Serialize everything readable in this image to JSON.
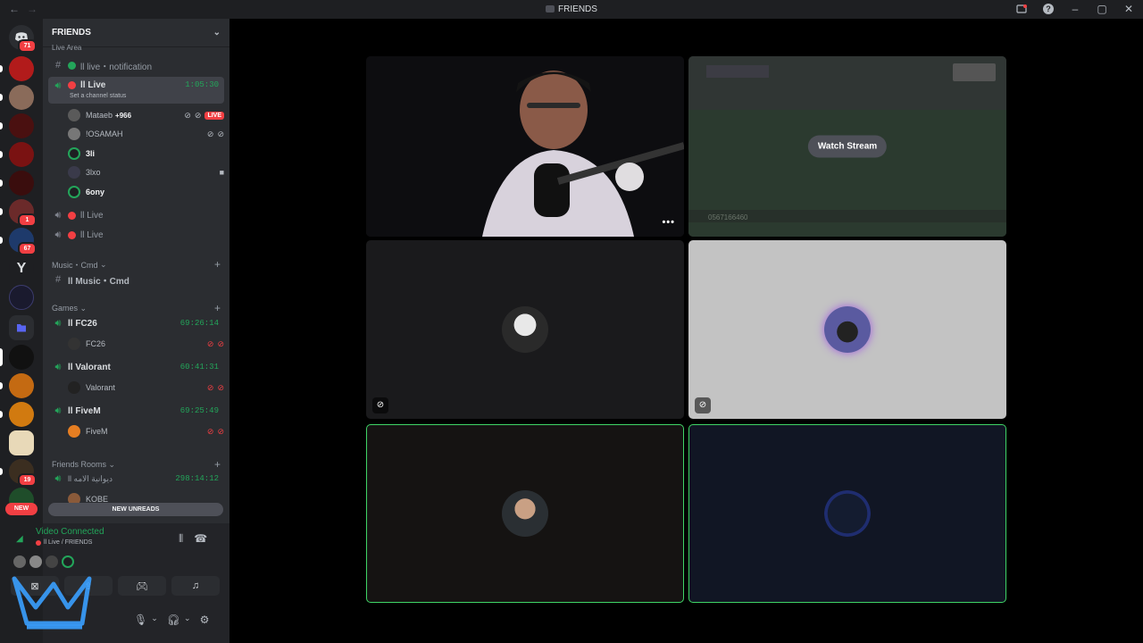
{
  "window": {
    "title": "FRIENDS"
  },
  "server_badges": {
    "home": "71",
    "s7": "1",
    "s8": "67",
    "s15": "19"
  },
  "new_pill": "NEW",
  "guild": {
    "name": "FRIENDS"
  },
  "top_category_partial": "Live Area",
  "channels": {
    "notification": "ll live・notification",
    "live_active": {
      "name": "ll Live",
      "timer": "1:05:30",
      "status": "Set a channel status"
    },
    "live2": "ll Live",
    "live3": "ll Live",
    "music_cat": "Music・Cmd",
    "music": "ll Music・Cmd",
    "games_cat": "Games",
    "fc26": {
      "name": "ll FC26",
      "timer": "69:26:14",
      "member": "FC26"
    },
    "valorant": {
      "name": "ll Valorant",
      "timer": "60:41:31",
      "member": "Valorant"
    },
    "fivem": {
      "name": "ll FiveM",
      "timer": "69:25:49",
      "member": "FiveM"
    },
    "friends_cat": "Friends Rooms",
    "friends_room": {
      "name": "ll ديوانية الامه",
      "timer": "298:14:12",
      "member": "KOBE"
    }
  },
  "members": {
    "mataeb": {
      "name": "Mataeb",
      "extra": "+966",
      "live": "LIVE"
    },
    "osamah": "!OSAMAH",
    "3li": "3li",
    "3lxo": "3lxo",
    "6ony": "6ony"
  },
  "new_unreads": "NEW UNREADS",
  "voice": {
    "status": "Video Connected",
    "location": "ll Live / FRIENDS"
  },
  "stage": {
    "watch_stream": "Watch Stream",
    "stream_banner_number": "0567166460"
  },
  "colors": {
    "accent_green": "#23a55a",
    "danger_red": "#f23f43",
    "sidebar": "#2b2d31",
    "rail": "#1e1f22"
  },
  "icons": [
    "discord-home-icon",
    "hashtag-icon",
    "speaker-icon",
    "mic-icon",
    "headphones-icon",
    "gear-icon",
    "camera-icon",
    "gamepad-icon",
    "screen-share-icon",
    "hangup-icon",
    "soundboard-icon",
    "chevron-down-icon",
    "plus-icon",
    "help-icon",
    "minimize-icon",
    "maximize-icon",
    "close-icon"
  ]
}
